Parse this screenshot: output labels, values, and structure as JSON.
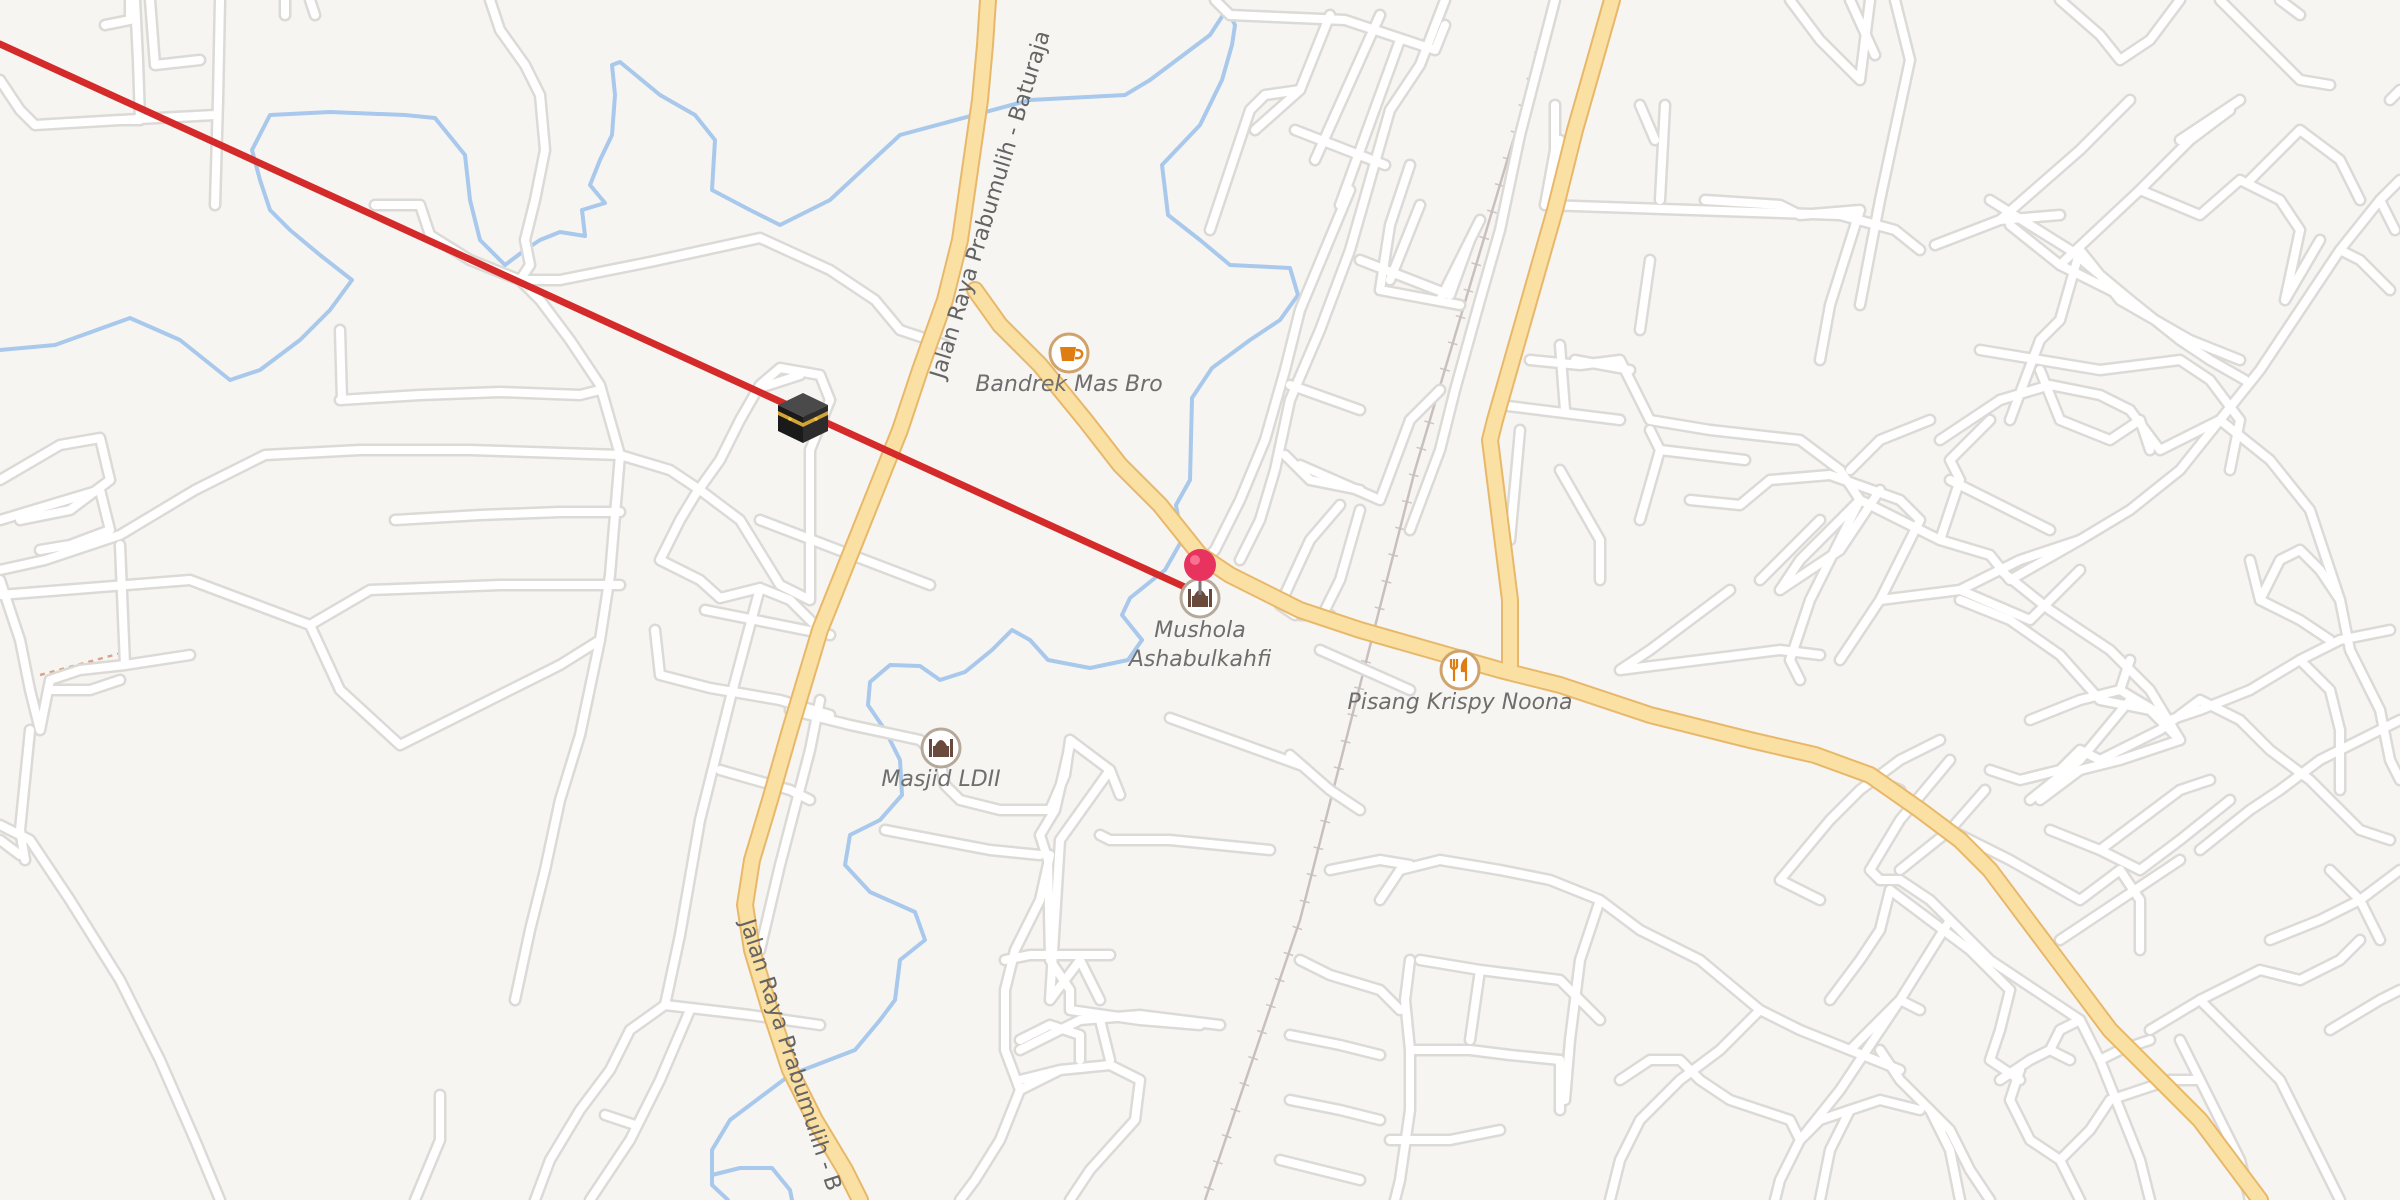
{
  "map": {
    "colors": {
      "background": "#f7f5f2",
      "minor_road": "#ffffff",
      "minor_road_casing": "#dcdad6",
      "major_road": "#fbe0a3",
      "major_road_casing": "#e8b86a",
      "river": "#a8c8ec",
      "railway": "#c9bfbf",
      "qibla_line": "#d42a2a",
      "pin": "#e8335f",
      "poi_icon_ring": "#cfa36b"
    },
    "roads": [
      {
        "name": "Jalan Raya Prabumulih - Baturaja",
        "label": "Jalan Raya Prabumulih - Baturaja"
      },
      {
        "name": "Jalan Raya Prabumulih - Baturaja (south)",
        "label": "Jalan Raya Prabumulih - B"
      }
    ],
    "pois": [
      {
        "name": "Bandrek Mas Bro",
        "icon": "coffee-cup-icon"
      },
      {
        "name": "Mushola Ashabulkahfi",
        "label_lines": [
          "Mushola",
          "Ashabulkahfi"
        ],
        "icon": "mosque-icon"
      },
      {
        "name": "Masjid LDII",
        "icon": "mosque-icon"
      },
      {
        "name": "Pisang Krispy Noona",
        "icon": "fork-knife-icon"
      }
    ],
    "markers": {
      "location_pin": "location-pin-icon",
      "kaaba": "kaaba-icon"
    }
  }
}
